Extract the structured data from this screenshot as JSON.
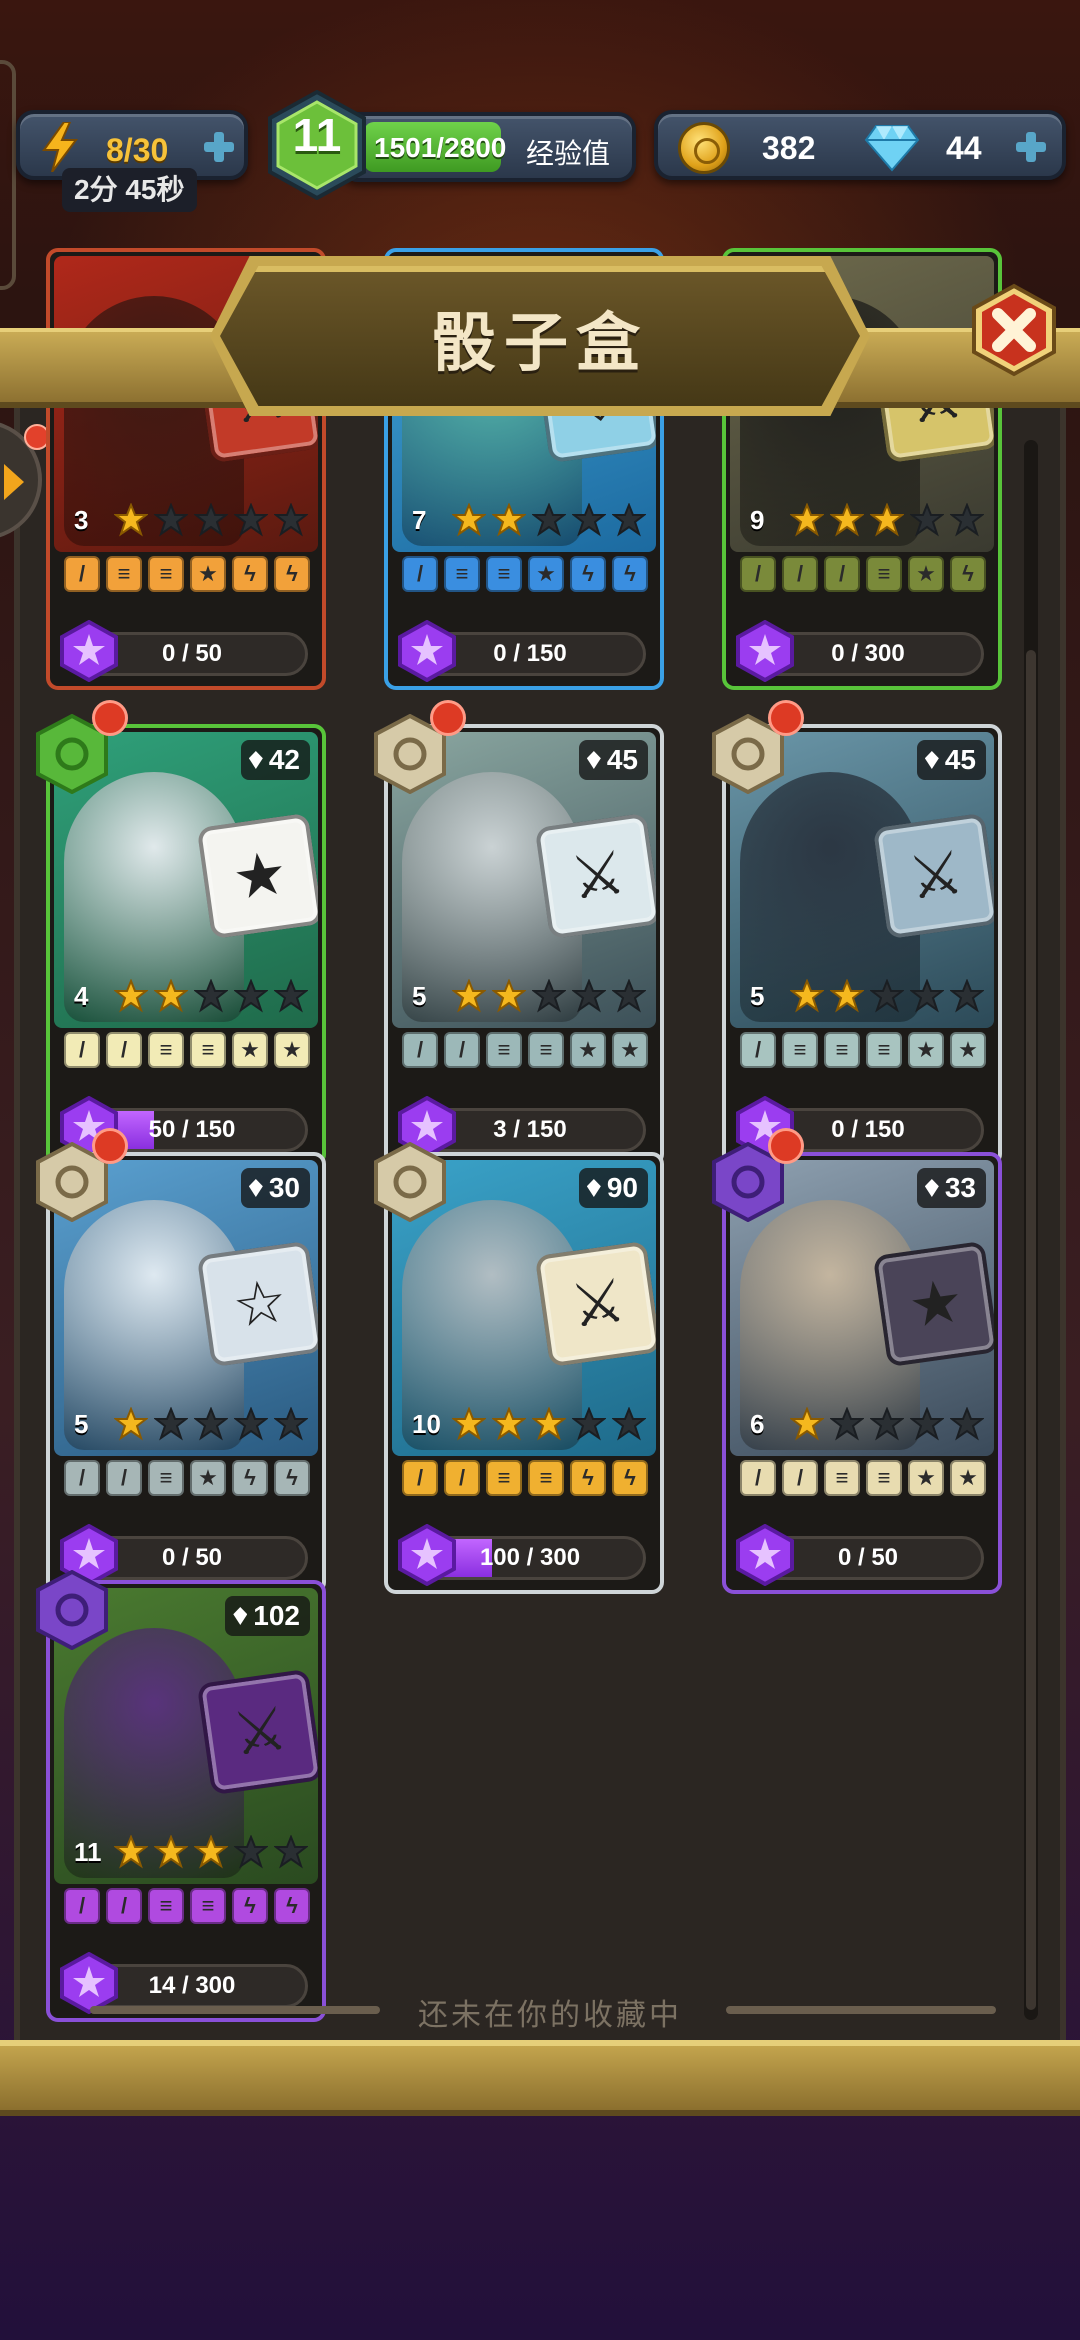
{
  "hud": {
    "energy": "8/30",
    "energy_timer": "2分 45秒",
    "level": "11",
    "xp_value": "1501/2800",
    "xp_label": "经验值",
    "xp_fraction": 0.536,
    "coins": "382",
    "gems": "44"
  },
  "title": "骰子盒",
  "footer": "还未在你的收藏中",
  "colors": {
    "progress": "#9b3df0",
    "accent_gold": "#c9ab55",
    "notification": "#dd3a24"
  },
  "cards": [
    {
      "id": "c1",
      "rarity": "red",
      "level": "3",
      "stars": 1,
      "gem_cost": null,
      "badge": null,
      "progress": "0 / 50",
      "progress_fraction": 0,
      "art_bg": [
        "#5a1a10",
        "#b0281a"
      ],
      "figure": "#3a1a14",
      "die_color": "#c23a28",
      "die_glyph": "⚔",
      "face_color": "#f2a13a",
      "faces": [
        "sword",
        "shield",
        "shield",
        "star",
        "bolt",
        "bolt"
      ]
    },
    {
      "id": "c2",
      "rarity": "blue",
      "level": "7",
      "stars": 2,
      "gem_cost": null,
      "badge": null,
      "progress": "0 / 150",
      "progress_fraction": 0,
      "art_bg": [
        "#1c6aa0",
        "#43a6d8"
      ],
      "figure": "#58b8a8",
      "die_color": "#8fd0e6",
      "die_glyph": "⛨",
      "face_color": "#3a8ee0",
      "faces": [
        "sword",
        "shield",
        "shield",
        "star",
        "bolt",
        "bolt"
      ]
    },
    {
      "id": "c3",
      "rarity": "green",
      "level": "9",
      "stars": 3,
      "gem_cost": null,
      "badge": null,
      "progress": "0 / 300",
      "progress_fraction": 0,
      "art_bg": [
        "#3a3a30",
        "#6e6a4c"
      ],
      "figure": "#1e1e1c",
      "die_color": "#d6c46a",
      "die_glyph": "⚔",
      "face_color": "#7a8a3a",
      "faces": [
        "sword",
        "sword",
        "sword",
        "shield",
        "star",
        "bolt"
      ]
    },
    {
      "id": "c4",
      "rarity": "green",
      "level": "4",
      "stars": 2,
      "gem_cost": "42",
      "badge": "leaf",
      "notify": true,
      "progress": "50 / 150",
      "progress_fraction": 0.333,
      "art_bg": [
        "#1f6a4a",
        "#2fa07a"
      ],
      "figure": "#eaeef2",
      "die_color": "#f4f4f0",
      "die_glyph": "★",
      "face_color": "#f2ebb6",
      "faces": [
        "sword",
        "sword",
        "shield",
        "shield",
        "star",
        "star"
      ]
    },
    {
      "id": "c5",
      "rarity": "silver",
      "level": "5",
      "stars": 2,
      "gem_cost": "45",
      "badge": "swirl",
      "notify": true,
      "progress": "3 / 150",
      "progress_fraction": 0.02,
      "art_bg": [
        "#3c5058",
        "#8aa6a0"
      ],
      "figure": "#cfd6d8",
      "die_color": "#dce8ec",
      "die_glyph": "⚔",
      "face_color": "#9cb8b8",
      "faces": [
        "sword",
        "sword",
        "shield",
        "shield",
        "star",
        "star"
      ]
    },
    {
      "id": "c6",
      "rarity": "silver",
      "level": "5",
      "stars": 2,
      "gem_cost": "45",
      "badge": "swirl",
      "notify": true,
      "progress": "0 / 150",
      "progress_fraction": 0,
      "art_bg": [
        "#2c4a58",
        "#6a96a8"
      ],
      "figure": "#2a3440",
      "die_color": "#9eb8c8",
      "die_glyph": "⚔",
      "face_color": "#a8c4c0",
      "faces": [
        "sword",
        "shield",
        "shield",
        "shield",
        "star",
        "star"
      ]
    },
    {
      "id": "c7",
      "rarity": "silver",
      "level": "5",
      "stars": 1,
      "gem_cost": "30",
      "badge": "swirl",
      "notify": true,
      "progress": "0 / 50",
      "progress_fraction": 0,
      "art_bg": [
        "#2a5a80",
        "#5aa0d0"
      ],
      "figure": "#e6eef4",
      "die_color": "#d8e2ea",
      "die_glyph": "☆",
      "face_color": "#a6b6b6",
      "faces": [
        "sword",
        "sword",
        "shield",
        "star",
        "bolt",
        "bolt"
      ]
    },
    {
      "id": "c8",
      "rarity": "silver",
      "level": "10",
      "stars": 3,
      "gem_cost": "90",
      "badge": "swirl",
      "notify": false,
      "progress": "100 / 300",
      "progress_fraction": 0.333,
      "art_bg": [
        "#1e6a8a",
        "#3aa2c8"
      ],
      "figure": "#b8c0c4",
      "die_color": "#efe6c8",
      "die_glyph": "⚔",
      "face_color": "#f0b030",
      "faces": [
        "sword",
        "sword",
        "shield",
        "shield",
        "bolt",
        "bolt"
      ]
    },
    {
      "id": "c9",
      "rarity": "purple",
      "level": "6",
      "stars": 1,
      "gem_cost": "33",
      "badge": "hex",
      "notify": true,
      "progress": "0 / 50",
      "progress_fraction": 0,
      "art_bg": [
        "#3a4a5a",
        "#8ea0b0"
      ],
      "figure": "#c8b8a0",
      "die_color": "#4a4458",
      "die_glyph": "★",
      "face_color": "#e8dcb0",
      "faces": [
        "sword",
        "sword",
        "shield",
        "shield",
        "star",
        "star"
      ]
    },
    {
      "id": "c10",
      "rarity": "purple",
      "level": "11",
      "stars": 3,
      "gem_cost": "102",
      "badge": "hex",
      "notify": false,
      "progress": "14 / 300",
      "progress_fraction": 0.047,
      "art_bg": [
        "#2a4a20",
        "#4a7a30"
      ],
      "figure": "#5a3080",
      "die_color": "#5a2a80",
      "die_glyph": "⚔",
      "face_color": "#b04ae0",
      "faces": [
        "sword",
        "sword",
        "shield",
        "shield",
        "bolt",
        "bolt"
      ]
    }
  ]
}
